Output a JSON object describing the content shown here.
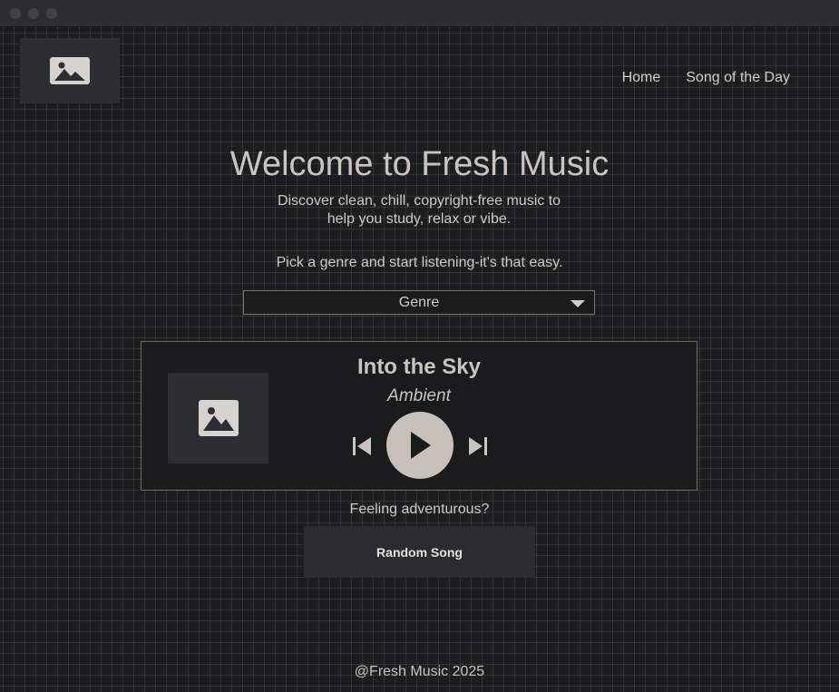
{
  "nav": {
    "items": [
      {
        "label": "Home"
      },
      {
        "label": "Song of the Day"
      }
    ]
  },
  "hero": {
    "title": "Welcome to Fresh Music",
    "subtitle": "Discover clean, chill, copyright-free music to help you study, relax or vibe.",
    "pick_text": "Pick a genre and start listening-it's that easy."
  },
  "genre_select": {
    "selected": "Genre"
  },
  "player": {
    "song_title": "Into the Sky",
    "song_genre": "Ambient"
  },
  "random": {
    "prompt": "Feeling adventurous?",
    "button_label": "Random Song"
  },
  "footer": {
    "text": "@Fresh Music 2025"
  },
  "colors": {
    "background": "#1c1d1e",
    "text": "#c9c4bf",
    "play_button": "#c8c1bb",
    "panel": "#2c2e31",
    "border": "#6e6b62"
  },
  "icons": {
    "logo": "image-placeholder-icon",
    "cover": "image-placeholder-icon",
    "prev": "skip-previous-icon",
    "play": "play-icon",
    "next": "skip-next-icon",
    "caret": "caret-down-icon"
  }
}
